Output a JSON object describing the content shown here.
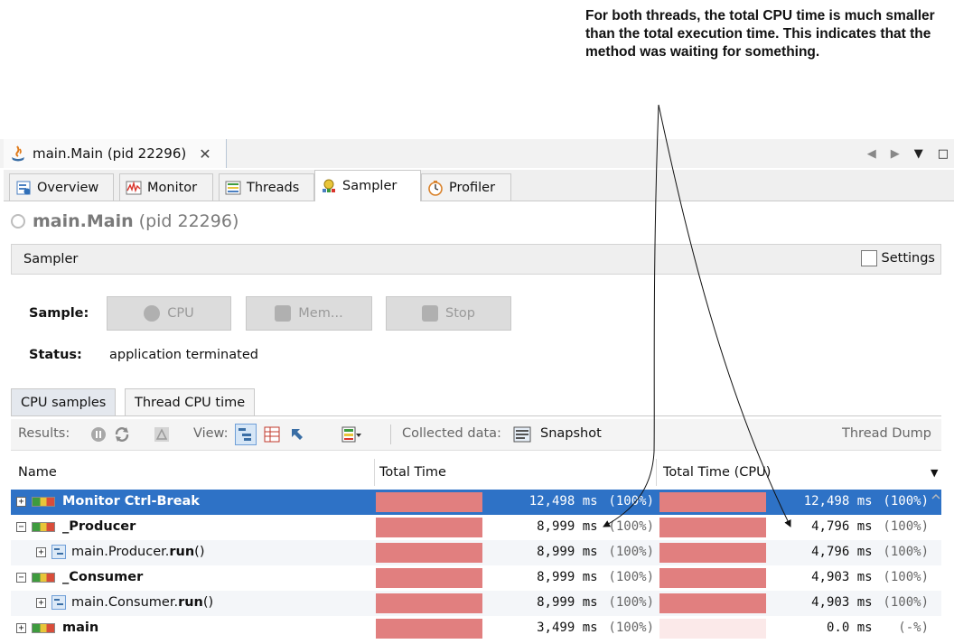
{
  "annotation": {
    "text": "For both threads, the total CPU time is much smaller than the total execution time. This indicates that the method was waiting for something."
  },
  "window": {
    "tab_title": "main.Main (pid 22296)",
    "close_glyph": "✕"
  },
  "subtabs": [
    {
      "label": "Overview",
      "icon": "overview-icon"
    },
    {
      "label": "Monitor",
      "icon": "monitor-icon"
    },
    {
      "label": "Threads",
      "icon": "threads-icon"
    },
    {
      "label": "Sampler",
      "icon": "sampler-icon",
      "active": true
    },
    {
      "label": "Profiler",
      "icon": "profiler-icon"
    }
  ],
  "process": {
    "name": "main.Main",
    "pid": "(pid 22296)"
  },
  "sampler_panel": {
    "label": "Sampler",
    "settings_label": "Settings"
  },
  "sample": {
    "label": "Sample:",
    "cpu_label": "CPU",
    "mem_label": "Mem...",
    "stop_label": "Stop"
  },
  "status": {
    "label": "Status:",
    "value": "application terminated"
  },
  "view_tabs": [
    {
      "label": "CPU samples",
      "active": true
    },
    {
      "label": "Thread CPU time"
    }
  ],
  "toolbar": {
    "results_label": "Results:",
    "view_label": "View:",
    "collected_label": "Collected data:",
    "snapshot_label": "Snapshot",
    "thread_dump_label": "Thread Dump"
  },
  "table": {
    "headers": {
      "name": "Name",
      "total_time": "Total Time",
      "total_time_cpu": "Total Time (CPU)"
    },
    "rows": [
      {
        "name": "Monitor Ctrl-Break",
        "kind": "thread",
        "selected": true,
        "time": "12,498 ms",
        "time_pct": "(100%)",
        "cpu": "12,498 ms",
        "cpu_pct": "(100%)",
        "time_fill": 1.0,
        "cpu_fill": 1.0
      },
      {
        "name": "_Producer",
        "kind": "thread",
        "time": "8,999 ms",
        "time_pct": "(100%)",
        "cpu": "4,796 ms",
        "cpu_pct": "(100%)",
        "time_fill": 1.0,
        "cpu_fill": 1.0
      },
      {
        "name_prefix": "main.Producer.",
        "name_bold": "run",
        "name_suffix": " ()",
        "kind": "method",
        "time": "8,999 ms",
        "time_pct": "(100%)",
        "cpu": "4,796 ms",
        "cpu_pct": "(100%)",
        "time_fill": 1.0,
        "cpu_fill": 1.0
      },
      {
        "name": "_Consumer",
        "kind": "thread",
        "time": "8,999 ms",
        "time_pct": "(100%)",
        "cpu": "4,903 ms",
        "cpu_pct": "(100%)",
        "time_fill": 1.0,
        "cpu_fill": 1.0
      },
      {
        "name_prefix": "main.Consumer.",
        "name_bold": "run",
        "name_suffix": " ()",
        "kind": "method",
        "time": "8,999 ms",
        "time_pct": "(100%)",
        "cpu": "4,903 ms",
        "cpu_pct": "(100%)",
        "time_fill": 1.0,
        "cpu_fill": 1.0
      },
      {
        "name": "main",
        "kind": "thread",
        "time": "3,499 ms",
        "time_pct": "(100%)",
        "cpu": "0.0 ms",
        "cpu_pct": "(-%)",
        "time_fill": 1.0,
        "cpu_fill": 0.0
      }
    ]
  },
  "colors": {
    "bar": "#e17f7f",
    "bar_empty": "#fbe9e9",
    "selection": "#2e72c6"
  }
}
